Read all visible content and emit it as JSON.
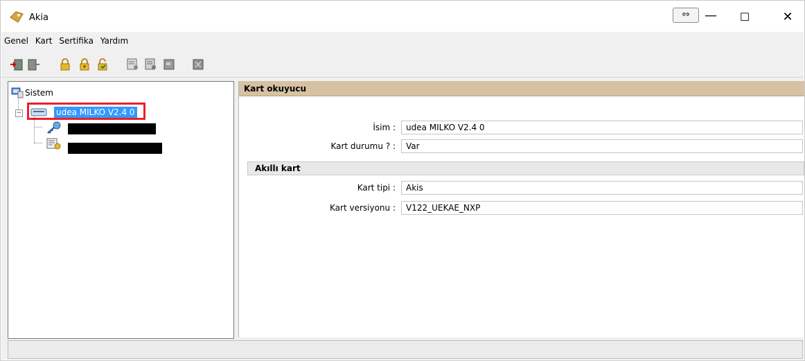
{
  "window": {
    "title": "Akia",
    "swap_glyph": "⇔",
    "minimize_glyph": "—",
    "maximize_glyph": "☐",
    "close_glyph": "✕"
  },
  "menu": [
    "Genel",
    "Kart",
    "Sertifika",
    "Yardım"
  ],
  "toolbar": {
    "icons": [
      "login-icon",
      "logout-icon",
      "lock-icon",
      "lock-key-icon",
      "unlock-icon",
      "cert-import-icon",
      "cert-export-icon",
      "card-icon",
      "card-delete-icon"
    ]
  },
  "tree": {
    "root_label": "Sistem",
    "expander_glyph": "−",
    "selected_item": "udea MILKO V2.4 0"
  },
  "detail": {
    "header": "Kart okuyucu",
    "fields": {
      "isim_label": "İsim :",
      "isim_value": "udea MILKO V2.4 0",
      "durum_label": "Kart durumu ? :",
      "durum_value": "Var"
    },
    "smartcard_header": "Akıllı kart",
    "smartcard": {
      "tip_label": "Kart tipi :",
      "tip_value": "Akis",
      "versiyon_label": "Kart versiyonu :",
      "versiyon_value": "V122_UEKAE_NXP"
    }
  },
  "colors": {
    "header_bg": "#d6c2a3",
    "selection": "#3399ff",
    "highlight_border": "#e8202a"
  }
}
